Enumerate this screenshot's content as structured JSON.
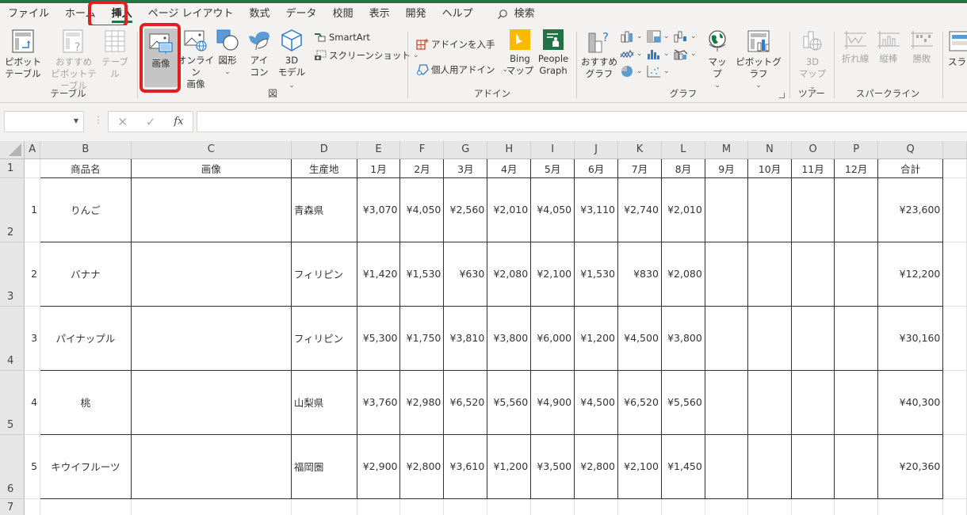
{
  "menu": {
    "tabs": [
      {
        "label": "ファイル"
      },
      {
        "label": "ホーム"
      },
      {
        "label": "挿入",
        "active": true
      },
      {
        "label": "ページ レイアウト"
      },
      {
        "label": "数式"
      },
      {
        "label": "データ"
      },
      {
        "label": "校閲"
      },
      {
        "label": "表示"
      },
      {
        "label": "開発"
      },
      {
        "label": "ヘルプ"
      }
    ],
    "search_label": "検索",
    "accent_color": "#217346",
    "highlight_color": "#e0201e"
  },
  "ribbon": {
    "groups": {
      "table": {
        "label": "テーブル",
        "pivot_table": "ピボット\nテーブル",
        "pivot_line1": "ピボット",
        "pivot_line2": "テーブル",
        "rec_pivot_line1": "おすすめ",
        "rec_pivot_line2": "ピボットテーブル",
        "table": "テーブル"
      },
      "illustrations": {
        "label": "図",
        "picture": "画像",
        "online_line1": "オンライン",
        "online_line2": "画像",
        "shapes": "図形",
        "icons_line1": "アイ",
        "icons_line2": "コン",
        "model_line1": "3D",
        "model_line2": "モデル",
        "smartart": "SmartArt",
        "screenshot": "スクリーンショット"
      },
      "addins": {
        "label": "アドイン",
        "get_addins": "アドインを入手",
        "my_addins": "個人用アドイン",
        "bing_line1": "Bing",
        "bing_line2": "マップ",
        "people_line1": "People",
        "people_line2": "Graph"
      },
      "charts": {
        "label": "グラフ",
        "rec_line1": "おすすめ",
        "rec_line2": "グラフ",
        "maps": "マップ",
        "pivot_chart": "ピボットグラフ"
      },
      "tours": {
        "label": "ツアー",
        "map3d_line1": "3D",
        "map3d_line2": "マップ"
      },
      "sparklines": {
        "label": "スパークライン",
        "line": "折れ線",
        "column": "縦棒",
        "winloss": "勝敗"
      },
      "slicer": {
        "label": "スライ"
      }
    }
  },
  "formula_bar": {
    "name_box": "",
    "formula": "",
    "fx": "fx"
  },
  "sheet": {
    "columns": [
      "A",
      "B",
      "C",
      "D",
      "E",
      "F",
      "G",
      "H",
      "I",
      "J",
      "K",
      "L",
      "M",
      "N",
      "O",
      "P",
      "Q"
    ],
    "row_numbers": [
      "1",
      "2",
      "3",
      "4",
      "5",
      "6",
      "7"
    ],
    "header": [
      "",
      "商品名",
      "画像",
      "生産地",
      "1月",
      "2月",
      "3月",
      "4月",
      "5月",
      "6月",
      "7月",
      "8月",
      "9月",
      "10月",
      "11月",
      "12月",
      "合計"
    ],
    "rows": [
      {
        "no": "1",
        "name": "りんご",
        "image": "",
        "origin": "青森県",
        "months": [
          "¥3,070",
          "¥4,050",
          "¥2,560",
          "¥2,010",
          "¥4,050",
          "¥3,110",
          "¥2,740",
          "¥2,010",
          "",
          "",
          "",
          ""
        ],
        "total": "¥23,600"
      },
      {
        "no": "2",
        "name": "バナナ",
        "image": "",
        "origin": "フィリピン",
        "months": [
          "¥1,420",
          "¥1,530",
          "¥630",
          "¥2,080",
          "¥2,100",
          "¥1,530",
          "¥830",
          "¥2,080",
          "",
          "",
          "",
          ""
        ],
        "total": "¥12,200"
      },
      {
        "no": "3",
        "name": "パイナップル",
        "image": "",
        "origin": "フィリピン",
        "months": [
          "¥5,300",
          "¥1,750",
          "¥3,810",
          "¥3,800",
          "¥6,000",
          "¥1,200",
          "¥4,500",
          "¥3,800",
          "",
          "",
          "",
          ""
        ],
        "total": "¥30,160"
      },
      {
        "no": "4",
        "name": "桃",
        "image": "",
        "origin": "山梨県",
        "months": [
          "¥3,760",
          "¥2,980",
          "¥6,520",
          "¥5,560",
          "¥4,900",
          "¥4,500",
          "¥6,520",
          "¥5,560",
          "",
          "",
          "",
          ""
        ],
        "total": "¥40,300"
      },
      {
        "no": "5",
        "name": "キウイフルーツ",
        "image": "",
        "origin": "福岡圏",
        "months": [
          "¥2,900",
          "¥2,800",
          "¥3,610",
          "¥1,200",
          "¥3,500",
          "¥2,800",
          "¥2,100",
          "¥1,450",
          "",
          "",
          "",
          ""
        ],
        "total": "¥20,360"
      }
    ]
  }
}
